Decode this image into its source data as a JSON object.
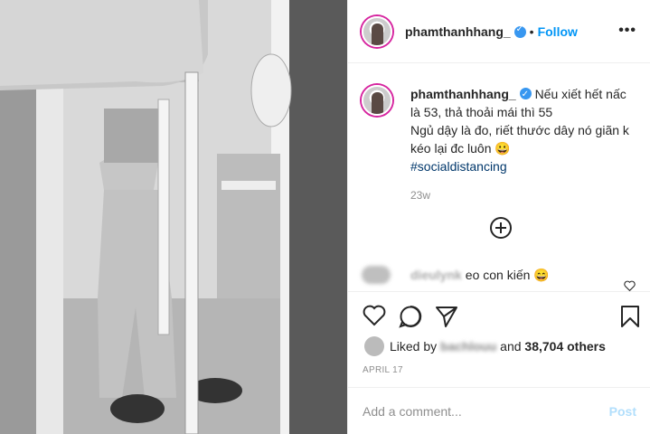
{
  "post": {
    "username": "phamthanhhang_",
    "follow_label": "Follow",
    "separator": "•",
    "more_label": "•••"
  },
  "caption": {
    "username": "phamthanhhang_",
    "line1": "Nếu xiết hết nấc là 53, thả thoải mái thì 55",
    "line2": "Ngủ dậy là đo, riết thước dây nó giãn k kéo lại đc luôn 😀",
    "hashtag": "#socialdistancing",
    "time_ago": "23w"
  },
  "comment": {
    "username": "dieulynk",
    "text": "eo con kiến 😄"
  },
  "likes": {
    "prefix": "Liked by",
    "user": "bachlouu",
    "and": "and",
    "count": "38,704 others"
  },
  "date": "APRIL 17",
  "add_comment": {
    "placeholder": "Add a comment...",
    "post_label": "Post"
  },
  "icons": [
    "verified-icon",
    "more-icon",
    "load-more-icon",
    "heart-icon",
    "comment-icon",
    "share-icon",
    "save-icon"
  ],
  "colors": {
    "link": "#0095f6",
    "hashtag": "#00376b",
    "muted": "#8e8e8e",
    "post_disabled": "#b2dffc"
  }
}
